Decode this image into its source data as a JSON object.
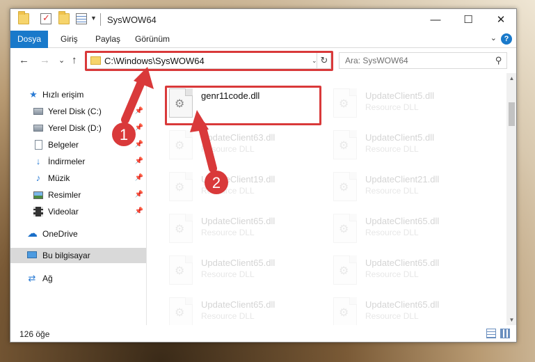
{
  "window": {
    "title": "SysWOW64"
  },
  "window_controls": {
    "minimize": "—",
    "maximize": "☐",
    "close": "✕"
  },
  "ribbon": {
    "tabs": [
      {
        "label": "Dosya",
        "active": true
      },
      {
        "label": "Giriş"
      },
      {
        "label": "Paylaş"
      },
      {
        "label": "Görünüm"
      }
    ],
    "expand_glyph": "⌄",
    "help_glyph": "?"
  },
  "nav": {
    "back": "←",
    "forward": "→",
    "recent": "⌄",
    "up": "↑",
    "address": "C:\\Windows\\SysWOW64",
    "address_dropdown": "⌄",
    "refresh": "↻",
    "search_placeholder": "Ara: SysWOW64"
  },
  "sidebar": {
    "items": [
      {
        "label": "Hızlı erişim",
        "icon": "star-icon"
      },
      {
        "label": "Yerel Disk (C:)",
        "icon": "drive-icon",
        "pinned": true
      },
      {
        "label": "Yerel Disk (D:)",
        "icon": "drive-icon",
        "pinned": true
      },
      {
        "label": "Belgeler",
        "icon": "documents-icon",
        "pinned": true
      },
      {
        "label": "İndirmeler",
        "icon": "download-icon",
        "pinned": true
      },
      {
        "label": "Müzik",
        "icon": "music-icon",
        "pinned": true
      },
      {
        "label": "Resimler",
        "icon": "pictures-icon",
        "pinned": true
      },
      {
        "label": "Videolar",
        "icon": "video-icon",
        "pinned": true
      },
      {
        "label": "OneDrive",
        "icon": "cloud-icon"
      },
      {
        "label": "Bu bilgisayar",
        "icon": "computer-icon",
        "selected": true
      },
      {
        "label": "Ağ",
        "icon": "network-icon"
      }
    ],
    "pin_glyph": "📌"
  },
  "files": [
    {
      "name": "genr11code.dll",
      "type": "",
      "highlighted": true
    },
    {
      "name": "UpdateClient5.dll",
      "type": "Resource DLL"
    },
    {
      "name": "UpdateClient63.dll",
      "type": "Resource DLL"
    },
    {
      "name": "UpdateClient5.dll",
      "type": "Resource DLL"
    },
    {
      "name": "UpdateClient19.dll",
      "type": "Resource DLL"
    },
    {
      "name": "UpdateClient21.dll",
      "type": "Resource DLL"
    },
    {
      "name": "UpdateClient65.dll",
      "type": "Resource DLL"
    },
    {
      "name": "UpdateClient65.dll",
      "type": "Resource DLL"
    },
    {
      "name": "UpdateClient65.dll",
      "type": "Resource DLL"
    },
    {
      "name": "UpdateClient65.dll",
      "type": "Resource DLL"
    },
    {
      "name": "UpdateClient65.dll",
      "type": "Resource DLL"
    },
    {
      "name": "UpdateClient65.dll",
      "type": "Resource DLL"
    }
  ],
  "status": {
    "item_count": "126 öğe"
  },
  "annotations": [
    {
      "label": "1",
      "color": "#d9393a"
    },
    {
      "label": "2",
      "color": "#d9393a"
    }
  ]
}
